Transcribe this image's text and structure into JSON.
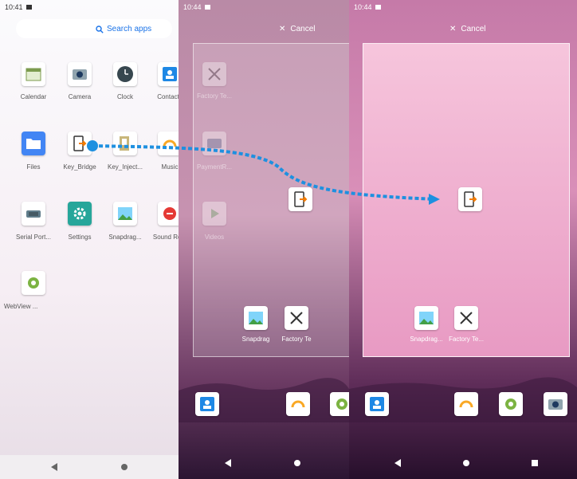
{
  "panel1": {
    "time": "10:41",
    "search_placeholder": "Search apps",
    "apps": [
      {
        "label": "Calendar",
        "icon": "calendar-icon"
      },
      {
        "label": "Camera",
        "icon": "camera-icon"
      },
      {
        "label": "Clock",
        "icon": "clock-icon"
      },
      {
        "label": "Contacts",
        "icon": "contacts-icon"
      },
      {
        "label": "Files",
        "icon": "files-icon"
      },
      {
        "label": "Key_Bridge",
        "icon": "key-bridge-icon"
      },
      {
        "label": "Key_Inject...",
        "icon": "key-injector-icon"
      },
      {
        "label": "Music",
        "icon": "music-icon"
      },
      {
        "label": "Serial Port...",
        "icon": "serial-port-icon"
      },
      {
        "label": "Settings",
        "icon": "settings-icon"
      },
      {
        "label": "Snapdrag...",
        "icon": "gallery-icon"
      },
      {
        "label": "Sound Re...",
        "icon": "sound-recorder-icon"
      },
      {
        "label": "WebView ...",
        "icon": "android-icon"
      }
    ]
  },
  "panel2": {
    "time": "10:44",
    "cancel_label": "Cancel",
    "ghost_apps": [
      {
        "label": "Factory Te...",
        "icon": "tools-icon"
      },
      {
        "label": "PaymentR...",
        "icon": "payment-icon"
      },
      {
        "label": "Videos",
        "icon": "video-icon"
      }
    ],
    "bottom_apps": [
      {
        "label": "Snapdrag",
        "icon": "gallery-icon"
      },
      {
        "label": "Factory Te",
        "icon": "tools-icon"
      }
    ]
  },
  "panel3": {
    "time": "10:44",
    "cancel_label": "Cancel",
    "bottom_apps": [
      {
        "label": "Snapdrag...",
        "icon": "gallery-icon"
      },
      {
        "label": "Factory Te...",
        "icon": "tools-icon"
      }
    ]
  },
  "colors": {
    "arrow": "#1e90e0",
    "accent_blue": "#1a73e8"
  }
}
